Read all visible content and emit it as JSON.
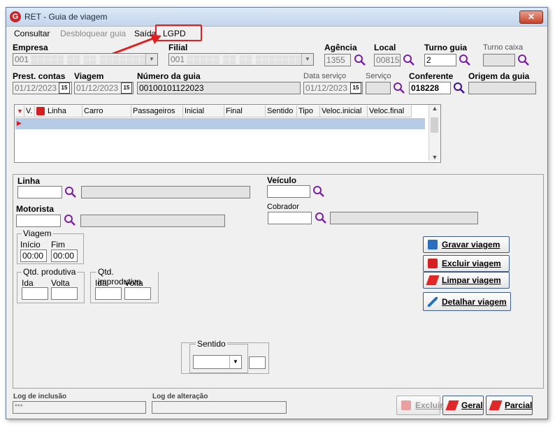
{
  "window": {
    "title": "RET - Guia de viagem",
    "close": "✕"
  },
  "menu": {
    "consultar": "Consultar",
    "desbloquear": "Desbloquear guia",
    "saida": "Saída",
    "lgpd": "LGPD"
  },
  "header": {
    "empresa_label": "Empresa",
    "empresa_value": "001",
    "filial_label": "Filial",
    "filial_value": "001",
    "agencia_label": "Agência",
    "agencia_value": "1355",
    "local_label": "Local",
    "local_value": "00815",
    "turno_guia_label": "Turno guia",
    "turno_guia_value": "2",
    "turno_caixa_label": "Turno caixa",
    "prest_label": "Prest. contas",
    "prest_value": "01/12/2023",
    "viagem_label": "Viagem",
    "viagem_value": "01/12/2023",
    "numero_label": "Número da guia",
    "numero_value": "00100101122023",
    "data_servico_label": "Data serviço",
    "data_servico_value": "01/12/2023",
    "servico_label": "Serviço",
    "conferente_label": "Conferente",
    "conferente_value": "018228",
    "origem_label": "Origem da guia"
  },
  "table": {
    "columns": [
      "V.",
      "Linha",
      "Carro",
      "Passageiros",
      "Inicial",
      "Final",
      "Sentido",
      "Tipo",
      "Veloc.inicial",
      "Veloc.final"
    ]
  },
  "form": {
    "linha_label": "Linha",
    "veiculo_label": "Veículo",
    "motorista_label": "Motorista",
    "cobrador_label": "Cobrador",
    "viagem_group": "Viagem",
    "inicio_label": "Início",
    "fim_label": "Fim",
    "inicio_value": "00:00",
    "fim_value": "00:00",
    "qtd_prod_group": "Qtd. produtiva",
    "qtd_improd_group": "Qtd. improdutiva",
    "ida_label": "Ida",
    "volta_label": "Volta",
    "sentido_label": "Sentido"
  },
  "buttons": {
    "gravar": "Gravar viagem",
    "excluir_viagem": "Excluir viagem",
    "limpar": "Limpar viagem",
    "detalhar": "Detalhar viagem",
    "excluir": "Excluir",
    "geral": "Geral",
    "parcial": "Parcial"
  },
  "footer": {
    "log_inclusao_label": "Log de inclusão",
    "log_inclusao_value": "***",
    "log_alteracao_label": "Log de alteração"
  },
  "colors": {
    "accent": "#c9252c",
    "highlight": "#e02020",
    "search": "#7b1fa2",
    "row_selected": "#b8cbe6"
  }
}
